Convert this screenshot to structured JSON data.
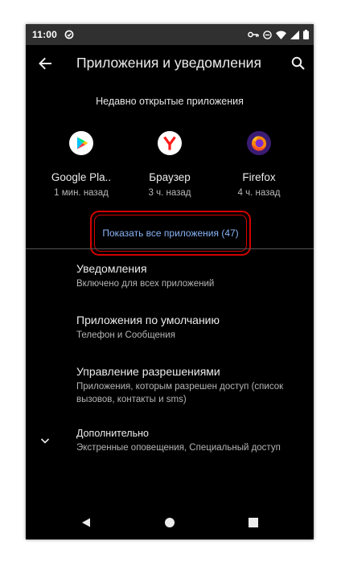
{
  "status_bar": {
    "time": "11:00",
    "icons": [
      "data-saver-icon",
      "vpn-key-icon",
      "do-not-disturb-icon",
      "wifi-icon",
      "signal-icon",
      "battery-icon"
    ]
  },
  "app_bar": {
    "title": "Приложения и уведомления",
    "back_icon": "arrow-back-icon",
    "search_icon": "search-icon"
  },
  "recent": {
    "label": "Недавно открытые приложения",
    "apps": [
      {
        "name": "Google Pla..",
        "time": "1 мин. назад",
        "icon": "google-play-icon"
      },
      {
        "name": "Браузер",
        "time": "3 ч. назад",
        "icon": "yandex-browser-icon"
      },
      {
        "name": "Firefox",
        "time": "4 ч. назад",
        "icon": "firefox-icon"
      }
    ]
  },
  "show_all": {
    "label": "Показать все приложения (47)",
    "highlight_color": "#d50000"
  },
  "settings": [
    {
      "title": "Уведомления",
      "subtitle": "Включено для всех приложений"
    },
    {
      "title": "Приложения по умолчанию",
      "subtitle": "Телефон и Сообщения"
    },
    {
      "title": "Управление разрешениями",
      "subtitle": "Приложения, которым разрешен доступ (список вызовов, контакты и sms)"
    },
    {
      "title": "Дополнительно",
      "subtitle": "Экстренные оповещения, Специальный доступ"
    }
  ],
  "nav_bar": {
    "icons": [
      "nav-back-icon",
      "nav-home-icon",
      "nav-recents-icon"
    ]
  },
  "colors": {
    "background": "#000000",
    "status_bar": "#303030",
    "accent": "#8ab4f8",
    "text": "#ececec",
    "secondary_text": "#b4b4b4"
  }
}
